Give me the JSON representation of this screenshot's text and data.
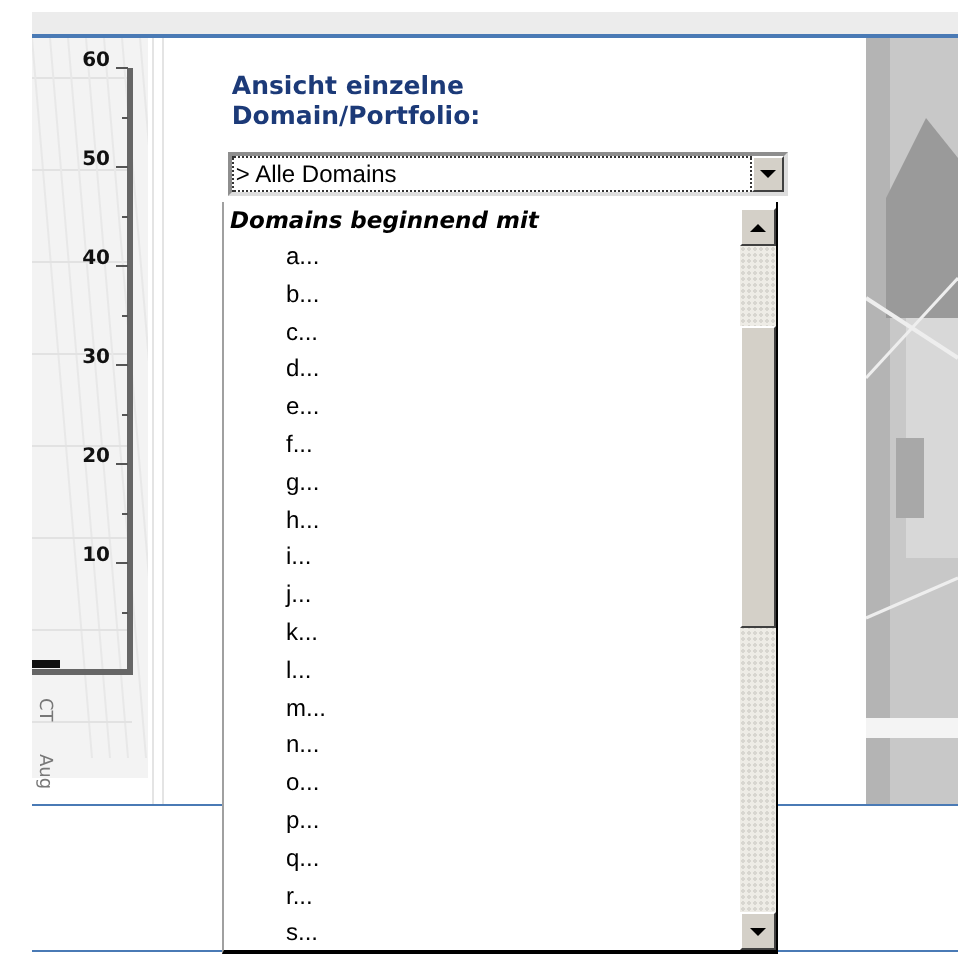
{
  "chart": {
    "y_labels": [
      "60",
      "50",
      "40",
      "30",
      "20",
      "10"
    ],
    "x_labels": [
      "CT",
      "Aug"
    ]
  },
  "view_selector": {
    "label": "Ansicht einzelne Domain/Portfolio:",
    "value": "> Alle Domains",
    "expanded": true
  },
  "dropdown_list": {
    "header": "Domains beginnend mit",
    "items": [
      "a...",
      "b...",
      "c...",
      "d...",
      "e...",
      "f...",
      "g...",
      "h...",
      "i...",
      "j...",
      "k...",
      "l...",
      "m...",
      "n...",
      "o...",
      "p...",
      "q...",
      "r...",
      "s..."
    ]
  }
}
